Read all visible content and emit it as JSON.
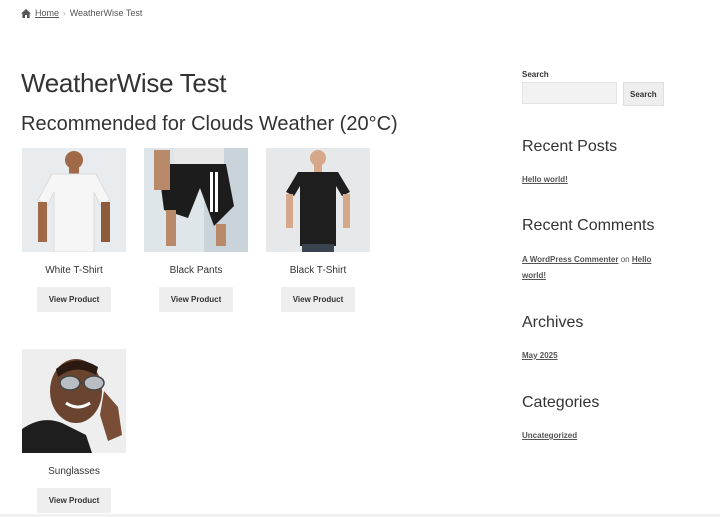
{
  "breadcrumb": {
    "home": "Home",
    "current": "WeatherWise Test"
  },
  "page": {
    "title": "WeatherWise Test",
    "section_heading": "Recommended for Clouds Weather (20°C)"
  },
  "products": [
    {
      "name": "White T-Shirt",
      "button": "View Product"
    },
    {
      "name": "Black Pants",
      "button": "View Product"
    },
    {
      "name": "Black T-Shirt",
      "button": "View Product"
    },
    {
      "name": "Sunglasses",
      "button": "View Product"
    }
  ],
  "sidebar": {
    "search": {
      "label": "Search",
      "placeholder": "",
      "button": "Search"
    },
    "recent_posts": {
      "title": "Recent Posts",
      "items": [
        "Hello world!"
      ]
    },
    "recent_comments": {
      "title": "Recent Comments",
      "author": "A WordPress Commenter",
      "on": "on",
      "post_line1": "Hello",
      "post_line2": "world!"
    },
    "archives": {
      "title": "Archives",
      "items": [
        "May 2025"
      ]
    },
    "categories": {
      "title": "Categories",
      "items": [
        "Uncategorized"
      ]
    }
  },
  "icons": {
    "breadcrumb_home": "home-icon"
  }
}
